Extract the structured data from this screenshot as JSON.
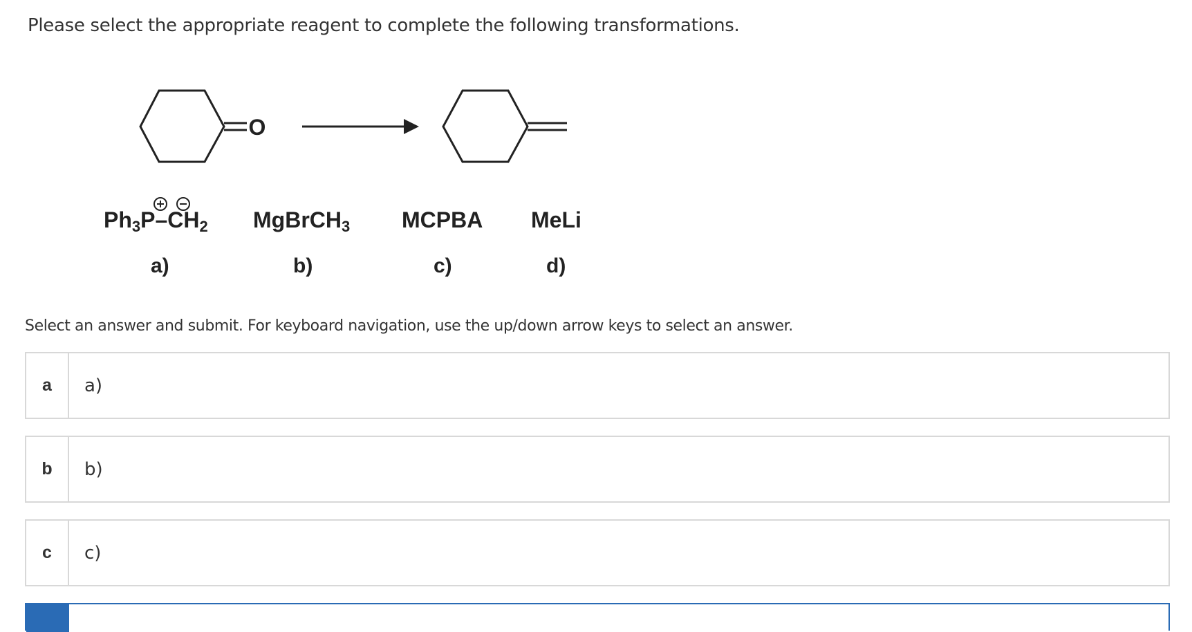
{
  "question": "Please select the appropriate reagent to complete the following transformations.",
  "reaction": {
    "reactant_heteroatom": "O",
    "reagents": [
      {
        "id": "a",
        "parts": [
          "Ph",
          "3",
          "P",
          "–CH",
          "2"
        ],
        "charges": [
          "+",
          "−"
        ],
        "option_label": "a)"
      },
      {
        "id": "b",
        "parts": [
          "MgBrCH",
          "3"
        ],
        "option_label": "b)"
      },
      {
        "id": "c",
        "parts": [
          "MCPBA"
        ],
        "option_label": "c)"
      },
      {
        "id": "d",
        "parts": [
          "MeLi"
        ],
        "option_label": "d)"
      }
    ]
  },
  "instructions": "Select an answer and submit. For keyboard navigation, use the up/down arrow keys to select an answer.",
  "choices": [
    {
      "letter": "a",
      "text": "a)"
    },
    {
      "letter": "b",
      "text": "b)"
    },
    {
      "letter": "c",
      "text": "c)"
    }
  ],
  "colors": {
    "text": "#333333",
    "border": "#d8d8d8",
    "selected_accent": "#2a6bb5"
  }
}
